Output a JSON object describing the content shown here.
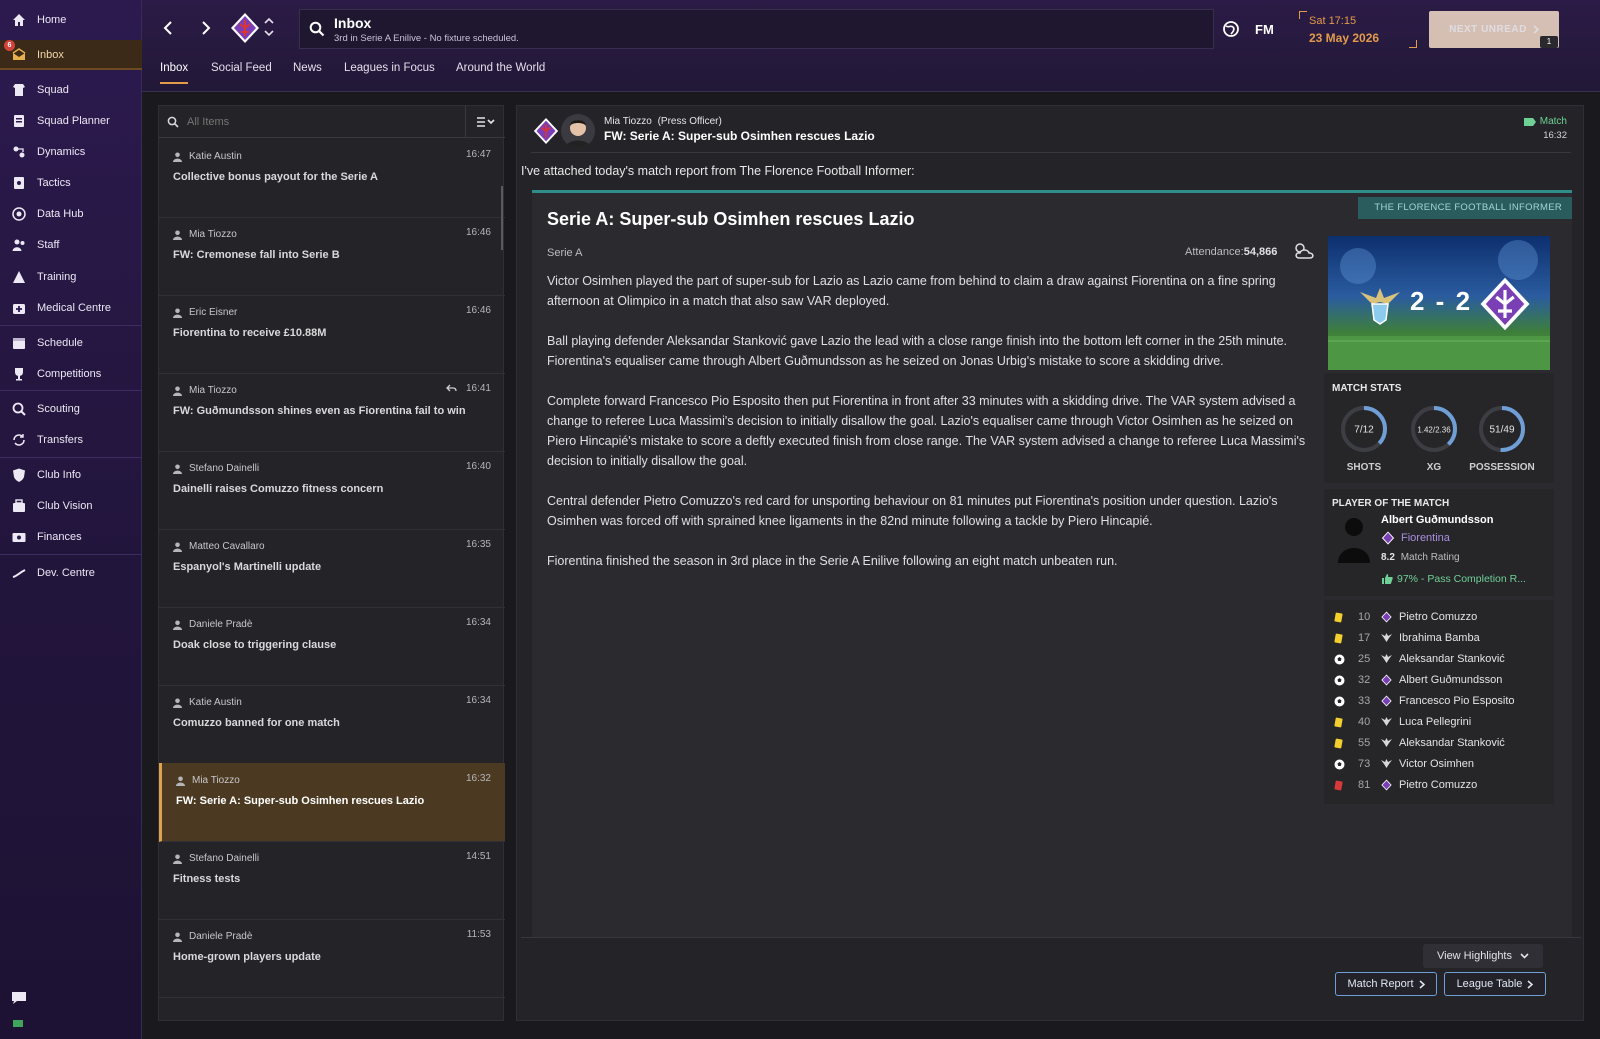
{
  "sidebar": {
    "inbox_badge": "6",
    "items": [
      {
        "label": "Home",
        "icon": "home-icon"
      },
      {
        "label": "Inbox",
        "icon": "inbox-icon"
      },
      {
        "label": "Squad",
        "icon": "squad-icon"
      },
      {
        "label": "Squad Planner",
        "icon": "planner-icon"
      },
      {
        "label": "Dynamics",
        "icon": "dynamics-icon"
      },
      {
        "label": "Tactics",
        "icon": "tactics-icon"
      },
      {
        "label": "Data Hub",
        "icon": "data-hub-icon"
      },
      {
        "label": "Staff",
        "icon": "staff-icon"
      },
      {
        "label": "Training",
        "icon": "training-icon"
      },
      {
        "label": "Medical Centre",
        "icon": "medical-icon"
      },
      {
        "label": "Schedule",
        "icon": "schedule-icon"
      },
      {
        "label": "Competitions",
        "icon": "trophy-icon"
      },
      {
        "label": "Scouting",
        "icon": "scouting-icon"
      },
      {
        "label": "Transfers",
        "icon": "transfers-icon"
      },
      {
        "label": "Club Info",
        "icon": "shield-icon"
      },
      {
        "label": "Club Vision",
        "icon": "vision-icon"
      },
      {
        "label": "Finances",
        "icon": "finances-icon"
      },
      {
        "label": "Dev. Centre",
        "icon": "dev-centre-icon"
      }
    ]
  },
  "header": {
    "title": "Inbox",
    "subtitle": "3rd in Serie A Enilive - No fixture scheduled.",
    "fm_label": "FM",
    "date_time": "Sat 17:15",
    "date": "23 May 2026",
    "next_unread": "NEXT UNREAD",
    "next_count": "1",
    "tabs": [
      "Inbox",
      "Social Feed",
      "News",
      "Leagues in Focus",
      "Around the World"
    ]
  },
  "list": {
    "search_placeholder": "All Items",
    "messages": [
      {
        "sender": "Katie Austin",
        "time": "16:47",
        "subject": "Collective bonus payout for the Serie A"
      },
      {
        "sender": "Mia Tiozzo",
        "time": "16:46",
        "subject": "FW: Cremonese fall into Serie B"
      },
      {
        "sender": "Eric Eisner",
        "time": "16:46",
        "subject": "Fiorentina to receive £10.88M"
      },
      {
        "sender": "Mia Tiozzo",
        "time": "16:41",
        "subject": "FW: Guðmundsson shines even as Fiorentina fail to win"
      },
      {
        "sender": "Stefano Dainelli",
        "time": "16:40",
        "subject": "Dainelli raises Comuzzo fitness concern"
      },
      {
        "sender": "Matteo Cavallaro",
        "time": "16:35",
        "subject": "Espanyol's Martinelli update"
      },
      {
        "sender": "Daniele Pradè",
        "time": "16:34",
        "subject": "Doak close to triggering clause"
      },
      {
        "sender": "Katie Austin",
        "time": "16:34",
        "subject": "Comuzzo banned for one match"
      },
      {
        "sender": "Mia Tiozzo",
        "time": "16:32",
        "subject": "FW: Serie A: Super-sub Osimhen rescues Lazio"
      },
      {
        "sender": "Stefano Dainelli",
        "time": "14:51",
        "subject": "Fitness tests"
      },
      {
        "sender": "Daniele Pradè",
        "time": "11:53",
        "subject": "Home-grown players update"
      }
    ]
  },
  "message": {
    "from": "Mia Tiozzo",
    "role": "(Press Officer)",
    "subject": "FW: Serie A: Super-sub Osimhen rescues Lazio",
    "category": "Match",
    "time": "16:32",
    "intro": "I've attached today's match report from The Florence Football Informer:",
    "source": "THE FLORENCE FOOTBALL INFORMER",
    "headline": "Serie A: Super-sub Osimhen rescues Lazio",
    "competition": "Serie A",
    "attendance_label": "Attendance:",
    "attendance": "54,866",
    "paragraphs": [
      "Victor Osimhen played the part of super-sub for Lazio as Lazio came from behind to claim a draw against Fiorentina on a fine spring afternoon at Olimpico in a match that also saw VAR deployed.",
      "Ball playing defender Aleksandar Stanković gave Lazio the lead with a close range finish into the bottom left corner in the 25th minute. Fiorentina's equaliser came through Albert Guðmundsson as he seized on Jonas Urbig's mistake to score a skidding drive.",
      "Complete forward Francesco Pio Esposito then put Fiorentina in front after 33 minutes with a skidding drive. The VAR system advised a change to referee Luca Massimi's decision to initially disallow the goal. Lazio's equaliser came through Victor Osimhen as he seized on Piero Hincapié's mistake to score a deftly executed finish from close range. The VAR system advised a change to referee Luca Massimi's decision to initially disallow the goal.",
      "Central defender Pietro Comuzzo's red card for unsporting behaviour on 81 minutes put Fiorentina's position under question. Lazio's Osimhen was forced off with sprained knee ligaments in the 82nd minute following a tackle by Piero Hincapié.",
      "Fiorentina finished the season in 3rd place in the Serie A Enilive following an eight match unbeaten run."
    ],
    "score": "2 - 2",
    "match_stats_title": "MATCH STATS",
    "stats": [
      {
        "value": "7/12",
        "label": "SHOTS",
        "home_fraction": 0.37
      },
      {
        "value": "1.42/2.36",
        "label": "XG",
        "home_fraction": 0.38
      },
      {
        "value": "51/49",
        "label": "POSSESSION",
        "home_fraction": 0.51
      }
    ],
    "potm_title": "PLAYER OF THE MATCH",
    "potm_name": "Albert Guðmundsson",
    "potm_club": "Fiorentina",
    "potm_rating": "8.2",
    "potm_rating_label": "Match Rating",
    "potm_highlight": "97% - Pass Completion R...",
    "events": [
      {
        "type": "yellow",
        "minute": "10",
        "club": "fiorentina",
        "player": "Pietro Comuzzo"
      },
      {
        "type": "yellow",
        "minute": "17",
        "club": "lazio",
        "player": "Ibrahima Bamba"
      },
      {
        "type": "goal",
        "minute": "25",
        "club": "lazio",
        "player": "Aleksandar Stanković"
      },
      {
        "type": "goal",
        "minute": "32",
        "club": "fiorentina",
        "player": "Albert Guðmundsson"
      },
      {
        "type": "goal",
        "minute": "33",
        "club": "fiorentina",
        "player": "Francesco Pio Esposito"
      },
      {
        "type": "yellow",
        "minute": "40",
        "club": "lazio",
        "player": "Luca Pellegrini"
      },
      {
        "type": "yellow",
        "minute": "55",
        "club": "lazio",
        "player": "Aleksandar Stanković"
      },
      {
        "type": "goal",
        "minute": "73",
        "club": "lazio",
        "player": "Victor Osimhen"
      },
      {
        "type": "red",
        "minute": "81",
        "club": "fiorentina",
        "player": "Pietro Comuzzo"
      }
    ],
    "view_highlights": "View Highlights",
    "match_report_btn": "Match Report",
    "league_table_btn": "League Table"
  },
  "colors": {
    "accent": "#e39a4b",
    "teal": "#2f8d8a",
    "link_blue": "#6f9fd6",
    "fiorentina": "#7b3fb5",
    "lazio_blue": "#8ccbee"
  }
}
